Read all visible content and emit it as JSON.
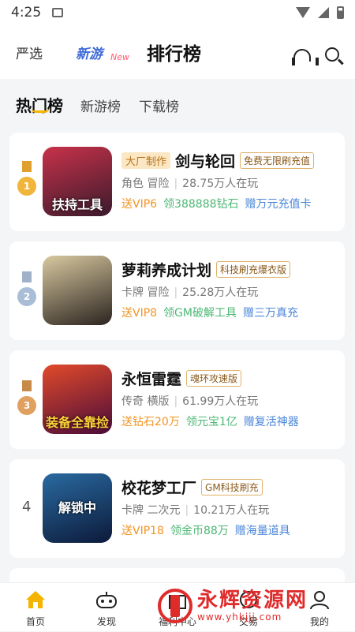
{
  "status": {
    "time": "4:25"
  },
  "header": {
    "tab_yanxuan": "严选",
    "tab_xinyou": "新游",
    "tab_new_badge": "New",
    "title": "排行榜"
  },
  "sub_tabs": [
    {
      "label": "热门榜",
      "active": true
    },
    {
      "label": "新游榜",
      "active": false
    },
    {
      "label": "下载榜",
      "active": false
    }
  ],
  "games": [
    {
      "rank": "1",
      "pre_tag": "大厂制作",
      "name": "剑与轮回",
      "tag": "免费无限刷充值",
      "genre": "角色 冒险",
      "players": "28.75万人在玩",
      "perks": [
        "送VIP6",
        "领388888钻石",
        "赠万元充值卡"
      ],
      "thumb_text": "扶持工具",
      "thumb_colors": [
        "#c8324a",
        "#3a1a2c"
      ]
    },
    {
      "rank": "2",
      "pre_tag": "",
      "name": "萝莉养成计划",
      "tag": "科技刷充爆衣版",
      "genre": "卡牌 冒险",
      "players": "25.28万人在玩",
      "perks": [
        "送VIP8",
        "领GM破解工具",
        "赠三万真充"
      ],
      "thumb_text": "",
      "thumb_colors": [
        "#d8c9a0",
        "#2c2420"
      ]
    },
    {
      "rank": "3",
      "pre_tag": "",
      "name": "永恒雷霆",
      "tag": "魂环攻速版",
      "genre": "传奇 横版",
      "players": "61.99万人在玩",
      "perks": [
        "送钻石20万",
        "领元宝1亿",
        "赠复活神器"
      ],
      "thumb_text": "装备全靠捡",
      "thumb_colors": [
        "#e24a2a",
        "#4a0c3a"
      ]
    },
    {
      "rank": "4",
      "pre_tag": "",
      "name": "校花梦工厂",
      "tag": "GM科技刷充",
      "genre": "卡牌 二次元",
      "players": "10.21万人在玩",
      "perks": [
        "送VIP18",
        "领金币88万",
        "赠海量道具"
      ],
      "thumb_text": "解锁中",
      "thumb_colors": [
        "#2a6aa0",
        "#0c1a3a"
      ]
    }
  ],
  "bottom_nav": [
    {
      "label": "首页",
      "icon": "home-icon"
    },
    {
      "label": "发现",
      "icon": "gamepad-icon"
    },
    {
      "label": "福利中心",
      "icon": "gift-icon"
    },
    {
      "label": "交易",
      "icon": "trade-icon"
    },
    {
      "label": "我的",
      "icon": "user-icon"
    }
  ],
  "watermark": {
    "main": "永辉资源网",
    "url": "www.yhkjjj.com"
  },
  "colors": {
    "gold": "#f0b53a",
    "silver": "#a9bdd6",
    "bronze": "#e0a060",
    "perk_orange": "#f39422",
    "perk_green": "#4cb875",
    "perk_blue": "#4b86d8",
    "accent_yellow": "#f5b400"
  }
}
